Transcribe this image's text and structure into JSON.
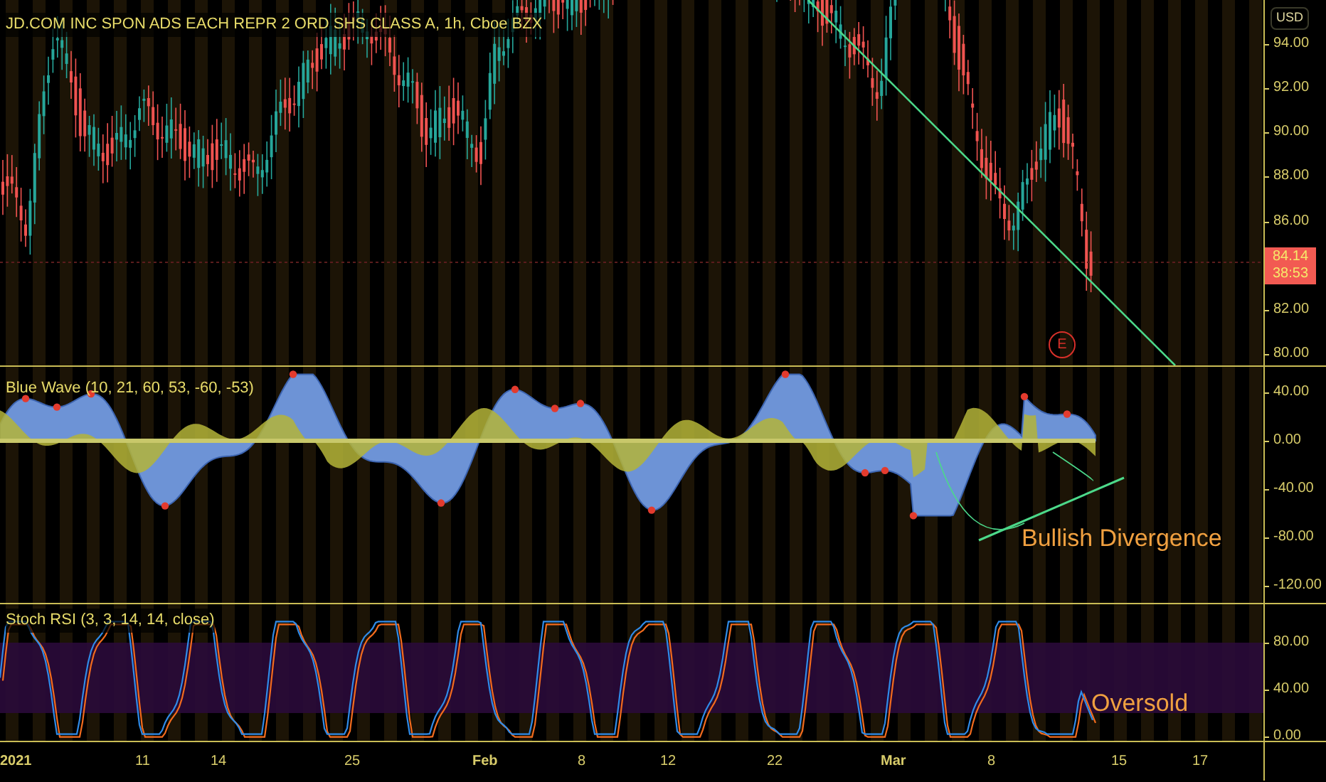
{
  "price_pane": {
    "title": "JD.COM INC SPON ADS EACH REPR 2 ORD SHS CLASS A, 1h, Cboe BZX",
    "currency": "USD",
    "axis_ticks": [
      "94.00",
      "92.00",
      "90.00",
      "88.00",
      "86.00",
      "82.00",
      "80.00"
    ],
    "last_price": {
      "price": "84.14",
      "countdown": "38:53"
    },
    "event_marker": "E"
  },
  "blue_wave_pane": {
    "title": "Blue Wave (10, 21, 60, 53, -60, -53)",
    "axis_ticks": [
      "40.00",
      "0.00",
      "-40.00",
      "-80.00",
      "-120.00"
    ],
    "annotation": "Bullish Divergence"
  },
  "stoch_rsi_pane": {
    "title": "Stoch RSI (3, 3, 14, 14, close)",
    "axis_ticks": [
      "80.00",
      "40.00",
      "0.00"
    ],
    "annotation": "Oversold"
  },
  "time_axis": [
    {
      "label": "2021",
      "major": true
    },
    {
      "label": "11",
      "major": false
    },
    {
      "label": "14",
      "major": false
    },
    {
      "label": "25",
      "major": false
    },
    {
      "label": "Feb",
      "major": true
    },
    {
      "label": "8",
      "major": false
    },
    {
      "label": "12",
      "major": false
    },
    {
      "label": "22",
      "major": false
    },
    {
      "label": "Mar",
      "major": true
    },
    {
      "label": "8",
      "major": false
    },
    {
      "label": "15",
      "major": false
    },
    {
      "label": "17",
      "major": false
    }
  ]
}
